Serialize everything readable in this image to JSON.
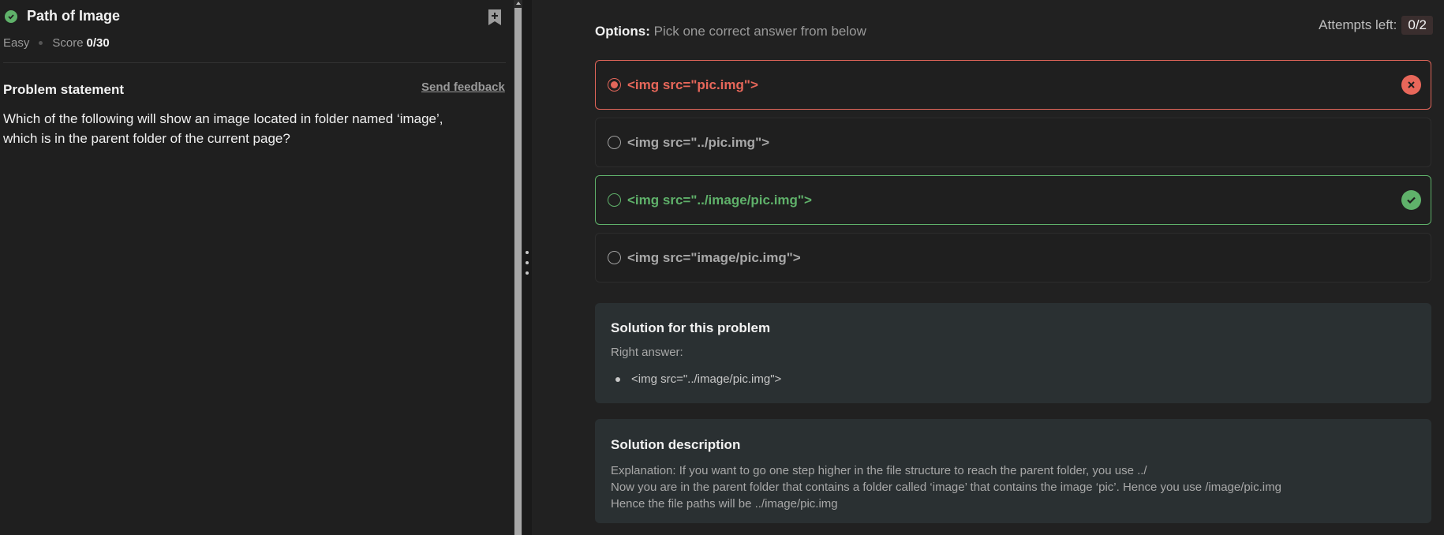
{
  "problem": {
    "title": "Path of Image",
    "difficulty": "Easy",
    "score_label": "Score",
    "score_value": "0/30",
    "statement_heading": "Problem statement",
    "send_feedback": "Send feedback",
    "statement_line1": "Which of the following will show an image located in folder named ‘image’,",
    "statement_line2": "which is in the parent folder of the current page?"
  },
  "options_panel": {
    "label_bold": "Options:",
    "label_rest": " Pick one correct answer from below",
    "attempts_label": "Attempts left:",
    "attempts_value": "0/2",
    "options": [
      {
        "text": "<img src=\"pic.img\">",
        "state": "wrong-selected"
      },
      {
        "text": "<img src=\"../pic.img\">",
        "state": "neutral"
      },
      {
        "text": "<img src=\"../image/pic.img\">",
        "state": "correct"
      },
      {
        "text": "<img src=\"image/pic.img\">",
        "state": "neutral"
      }
    ]
  },
  "solution": {
    "heading": "Solution for this problem",
    "right_answer_label": "Right answer:",
    "right_answer": "<img src=\"../image/pic.img\">"
  },
  "description": {
    "heading": "Solution description",
    "line1": "Explanation: If you want to go one step higher in the file structure to reach the parent folder, you use ../",
    "line2": "Now you are in the parent folder that contains a folder called ‘image’ that contains the image ‘pic’. Hence you use /image/pic.img",
    "line3": "Hence the file paths will be ../image/pic.img"
  },
  "colors": {
    "wrong": "#e8675a",
    "correct": "#5fb16a",
    "background": "#1f1f1f",
    "card": "#2a3032"
  }
}
